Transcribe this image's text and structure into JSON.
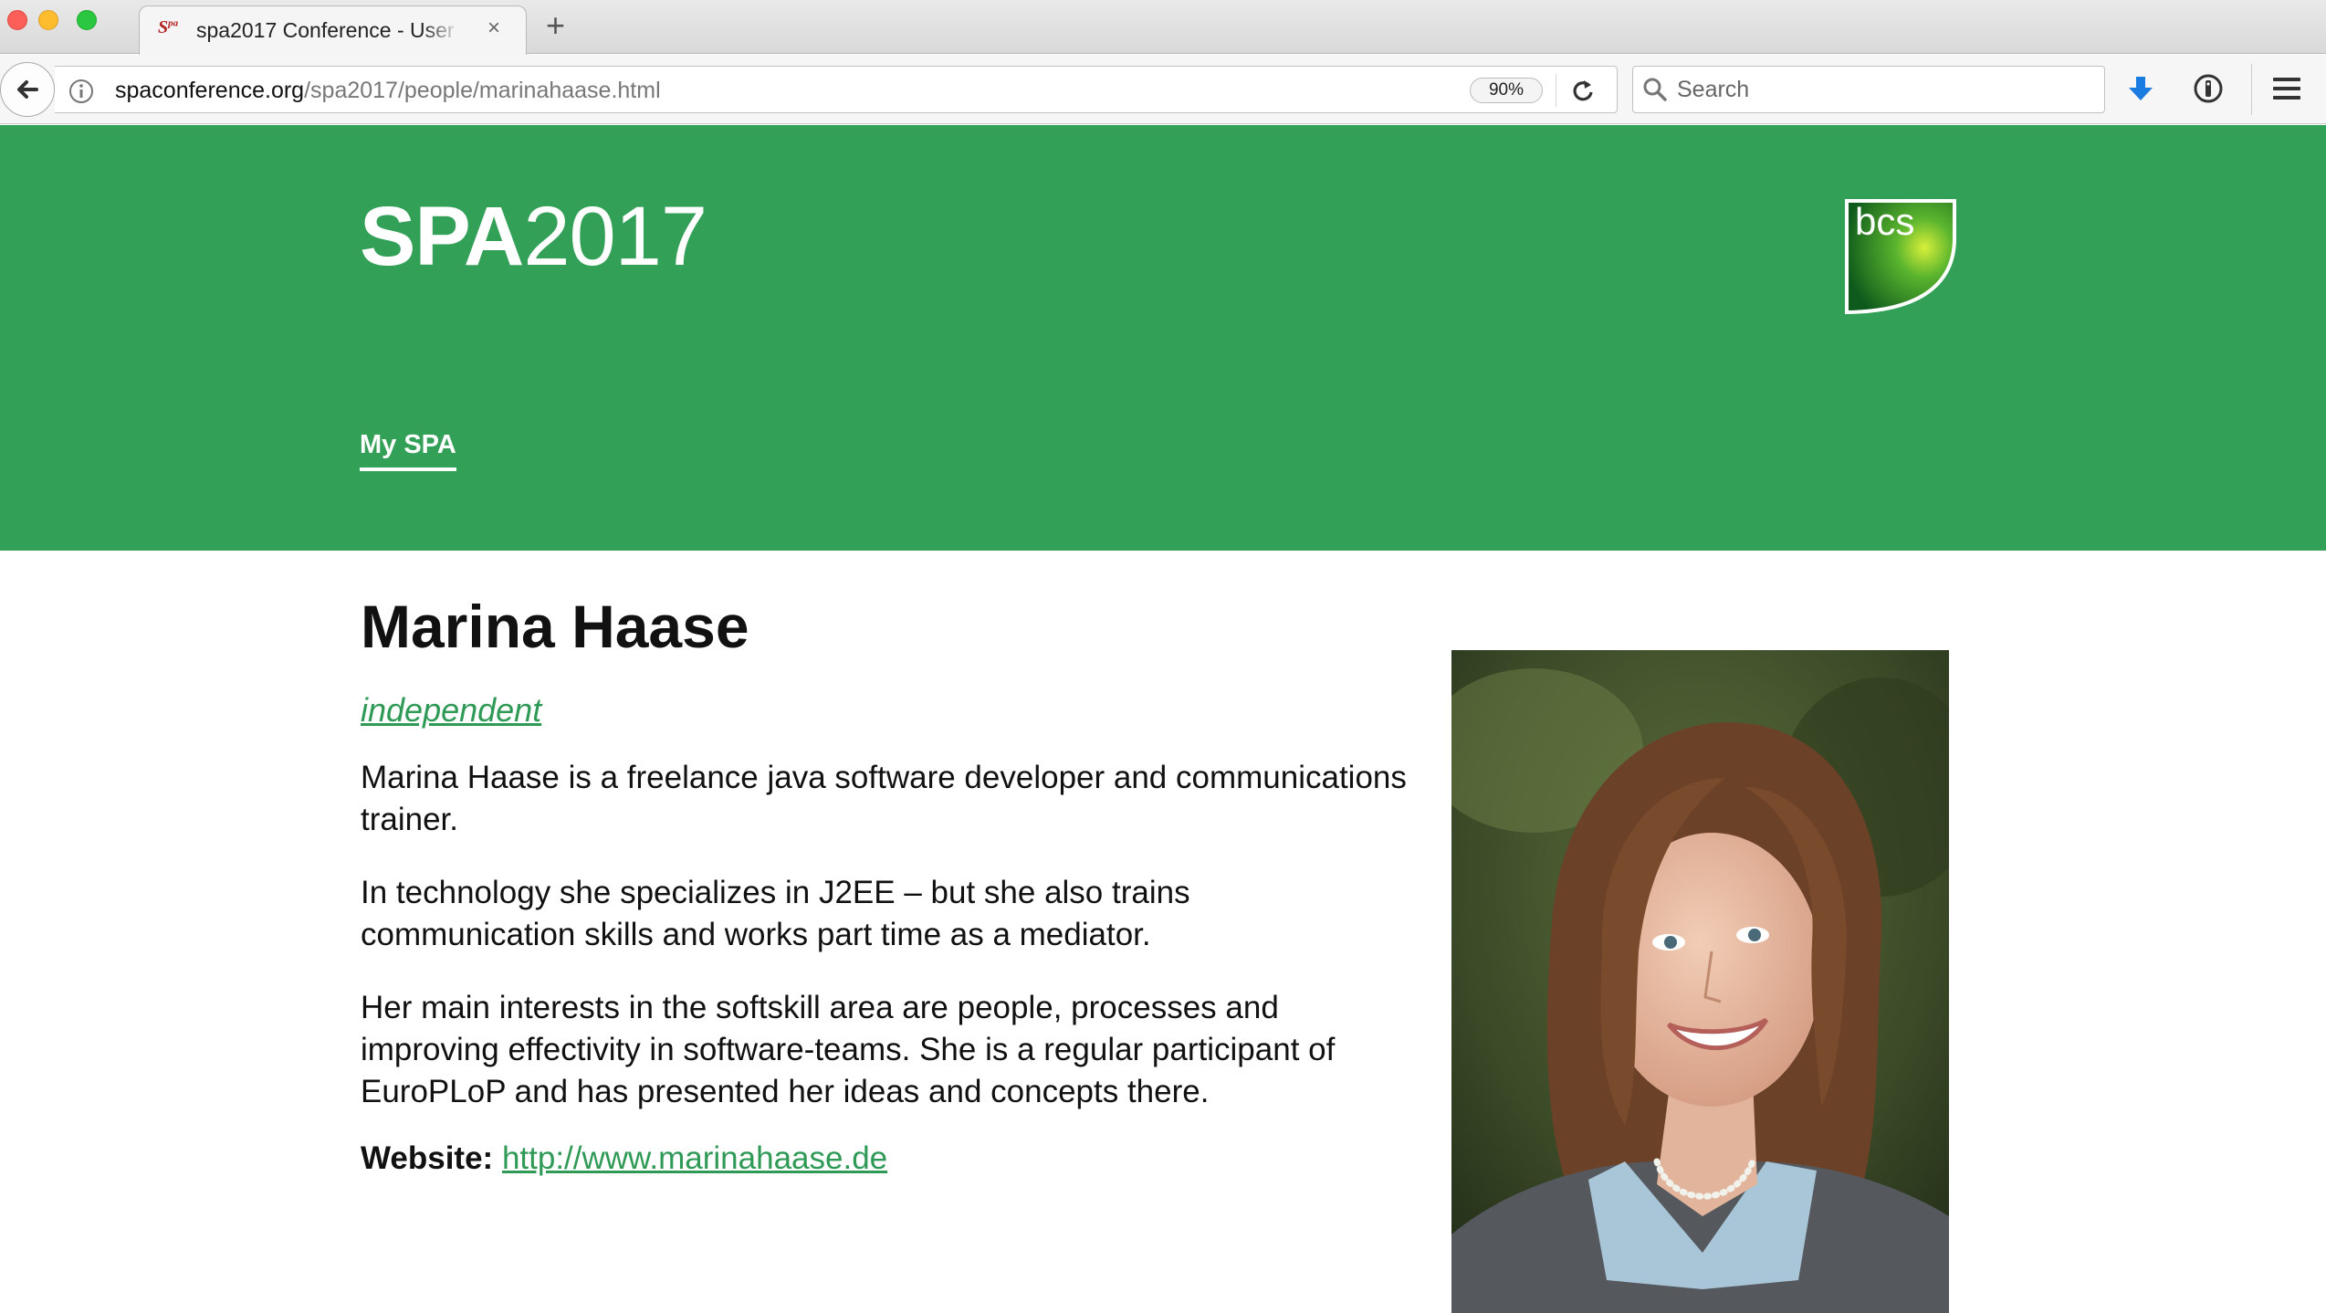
{
  "browser": {
    "tab": {
      "favicon": "Spa",
      "title": "spa2017 Conference - User fo",
      "close_label": "×"
    },
    "new_tab_label": "+",
    "url": {
      "host": "spaconference.org",
      "path": "/spa2017/people/marinahaase.html"
    },
    "zoom": "90%",
    "search_placeholder": "Search",
    "icons": [
      "back-arrow-icon",
      "info-icon",
      "reload-icon",
      "search-icon",
      "download-icon",
      "password-icon",
      "hamburger-menu-icon"
    ]
  },
  "site": {
    "title_bold": "SPA",
    "title_light": "2017",
    "logo_text": "bcs",
    "nav": {
      "my_spa": "My SPA"
    }
  },
  "person": {
    "name": "Marina Haase",
    "affiliation": "independent",
    "bio": [
      "Marina Haase is a freelance java software developer and communications trainer.",
      "In technology she specializes in J2EE – but she also trains communication skills and works part time as a mediator.",
      "Her main interests in the softskill area are people, processes and improving effectivity in software-teams. She is a regular participant of EuroPLoP and has presented her ideas and concepts there."
    ],
    "website_label": "Website:",
    "website_url": "http://www.marinahaase.de"
  },
  "colors": {
    "header_green": "#33a058",
    "link_green": "#2f9a56"
  }
}
